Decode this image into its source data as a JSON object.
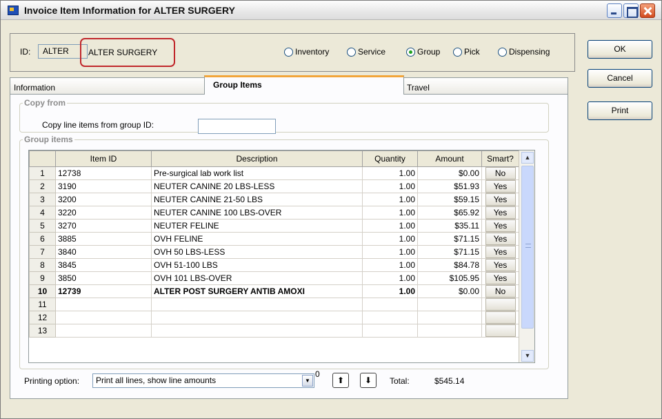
{
  "window": {
    "title": "Invoice Item Information for ALTER SURGERY"
  },
  "header": {
    "id_label": "ID:",
    "id_value": "ALTER",
    "name_value": "ALTER SURGERY",
    "type_options": [
      {
        "label": "Inventory",
        "selected": false
      },
      {
        "label": "Service",
        "selected": false
      },
      {
        "label": "Group",
        "selected": true
      },
      {
        "label": "Pick",
        "selected": false
      },
      {
        "label": "Dispensing",
        "selected": false
      }
    ]
  },
  "buttons": {
    "ok": "OK",
    "cancel": "Cancel",
    "print": "Print"
  },
  "tabs": [
    {
      "label": "Information",
      "active": false
    },
    {
      "label": "Group Items",
      "active": true
    },
    {
      "label": "Travel",
      "active": false
    }
  ],
  "copy_from": {
    "legend": "Copy from",
    "label": "Copy line items from group ID:",
    "value": ""
  },
  "group_items": {
    "legend": "Group  items",
    "columns": [
      "Item ID",
      "Description",
      "Quantity",
      "Amount",
      "Smart?"
    ],
    "rows": [
      {
        "num": "1",
        "item_id": "12738",
        "description": "Pre-surgical lab work list",
        "quantity": "1.00",
        "amount": "$0.00",
        "smart": "No"
      },
      {
        "num": "2",
        "item_id": "3190",
        "description": "NEUTER CANINE  20 LBS-LESS",
        "quantity": "1.00",
        "amount": "$51.93",
        "smart": "Yes"
      },
      {
        "num": "3",
        "item_id": "3200",
        "description": "NEUTER CANINE  21-50 LBS",
        "quantity": "1.00",
        "amount": "$59.15",
        "smart": "Yes"
      },
      {
        "num": "4",
        "item_id": "3220",
        "description": "NEUTER CANINE 100 LBS-OVER",
        "quantity": "1.00",
        "amount": "$65.92",
        "smart": "Yes"
      },
      {
        "num": "5",
        "item_id": "3270",
        "description": "NEUTER FELINE",
        "quantity": "1.00",
        "amount": "$35.11",
        "smart": "Yes"
      },
      {
        "num": "6",
        "item_id": "3885",
        "description": "OVH FELINE",
        "quantity": "1.00",
        "amount": "$71.15",
        "smart": "Yes"
      },
      {
        "num": "7",
        "item_id": "3840",
        "description": "OVH 50 LBS-LESS",
        "quantity": "1.00",
        "amount": "$71.15",
        "smart": "Yes"
      },
      {
        "num": "8",
        "item_id": "3845",
        "description": "OVH 51-100 LBS",
        "quantity": "1.00",
        "amount": "$84.78",
        "smart": "Yes"
      },
      {
        "num": "9",
        "item_id": "3850",
        "description": "OVH 101 LBS-OVER",
        "quantity": "1.00",
        "amount": "$105.95",
        "smart": "Yes"
      },
      {
        "num": "10",
        "item_id": "12739",
        "description": "ALTER POST SURGERY ANTIB AMOXI",
        "quantity": "1.00",
        "amount": "$0.00",
        "smart": "No",
        "bold": true
      },
      {
        "num": "11",
        "item_id": "",
        "description": "",
        "quantity": "",
        "amount": "",
        "smart": ""
      },
      {
        "num": "12",
        "item_id": "",
        "description": "",
        "quantity": "",
        "amount": "",
        "smart": ""
      },
      {
        "num": "13",
        "item_id": "",
        "description": "",
        "quantity": "",
        "amount": "",
        "smart": ""
      }
    ]
  },
  "footer": {
    "printing_option_label": "Printing option:",
    "printing_option_value": "Print all lines, show line amounts",
    "option_count": "0",
    "total_label": "Total:",
    "total_value": "$545.14"
  },
  "icons": {
    "minimize": "minimize-icon",
    "maximize": "maximize-icon",
    "close": "close-icon",
    "up_arrow": "arrow-up-icon",
    "down_arrow": "arrow-down-icon",
    "dropdown": "chevron-down-icon"
  },
  "colors": {
    "accent_tab": "#f2a53a",
    "highlight_border": "#c0262a",
    "radio_selected": "#21a121"
  }
}
